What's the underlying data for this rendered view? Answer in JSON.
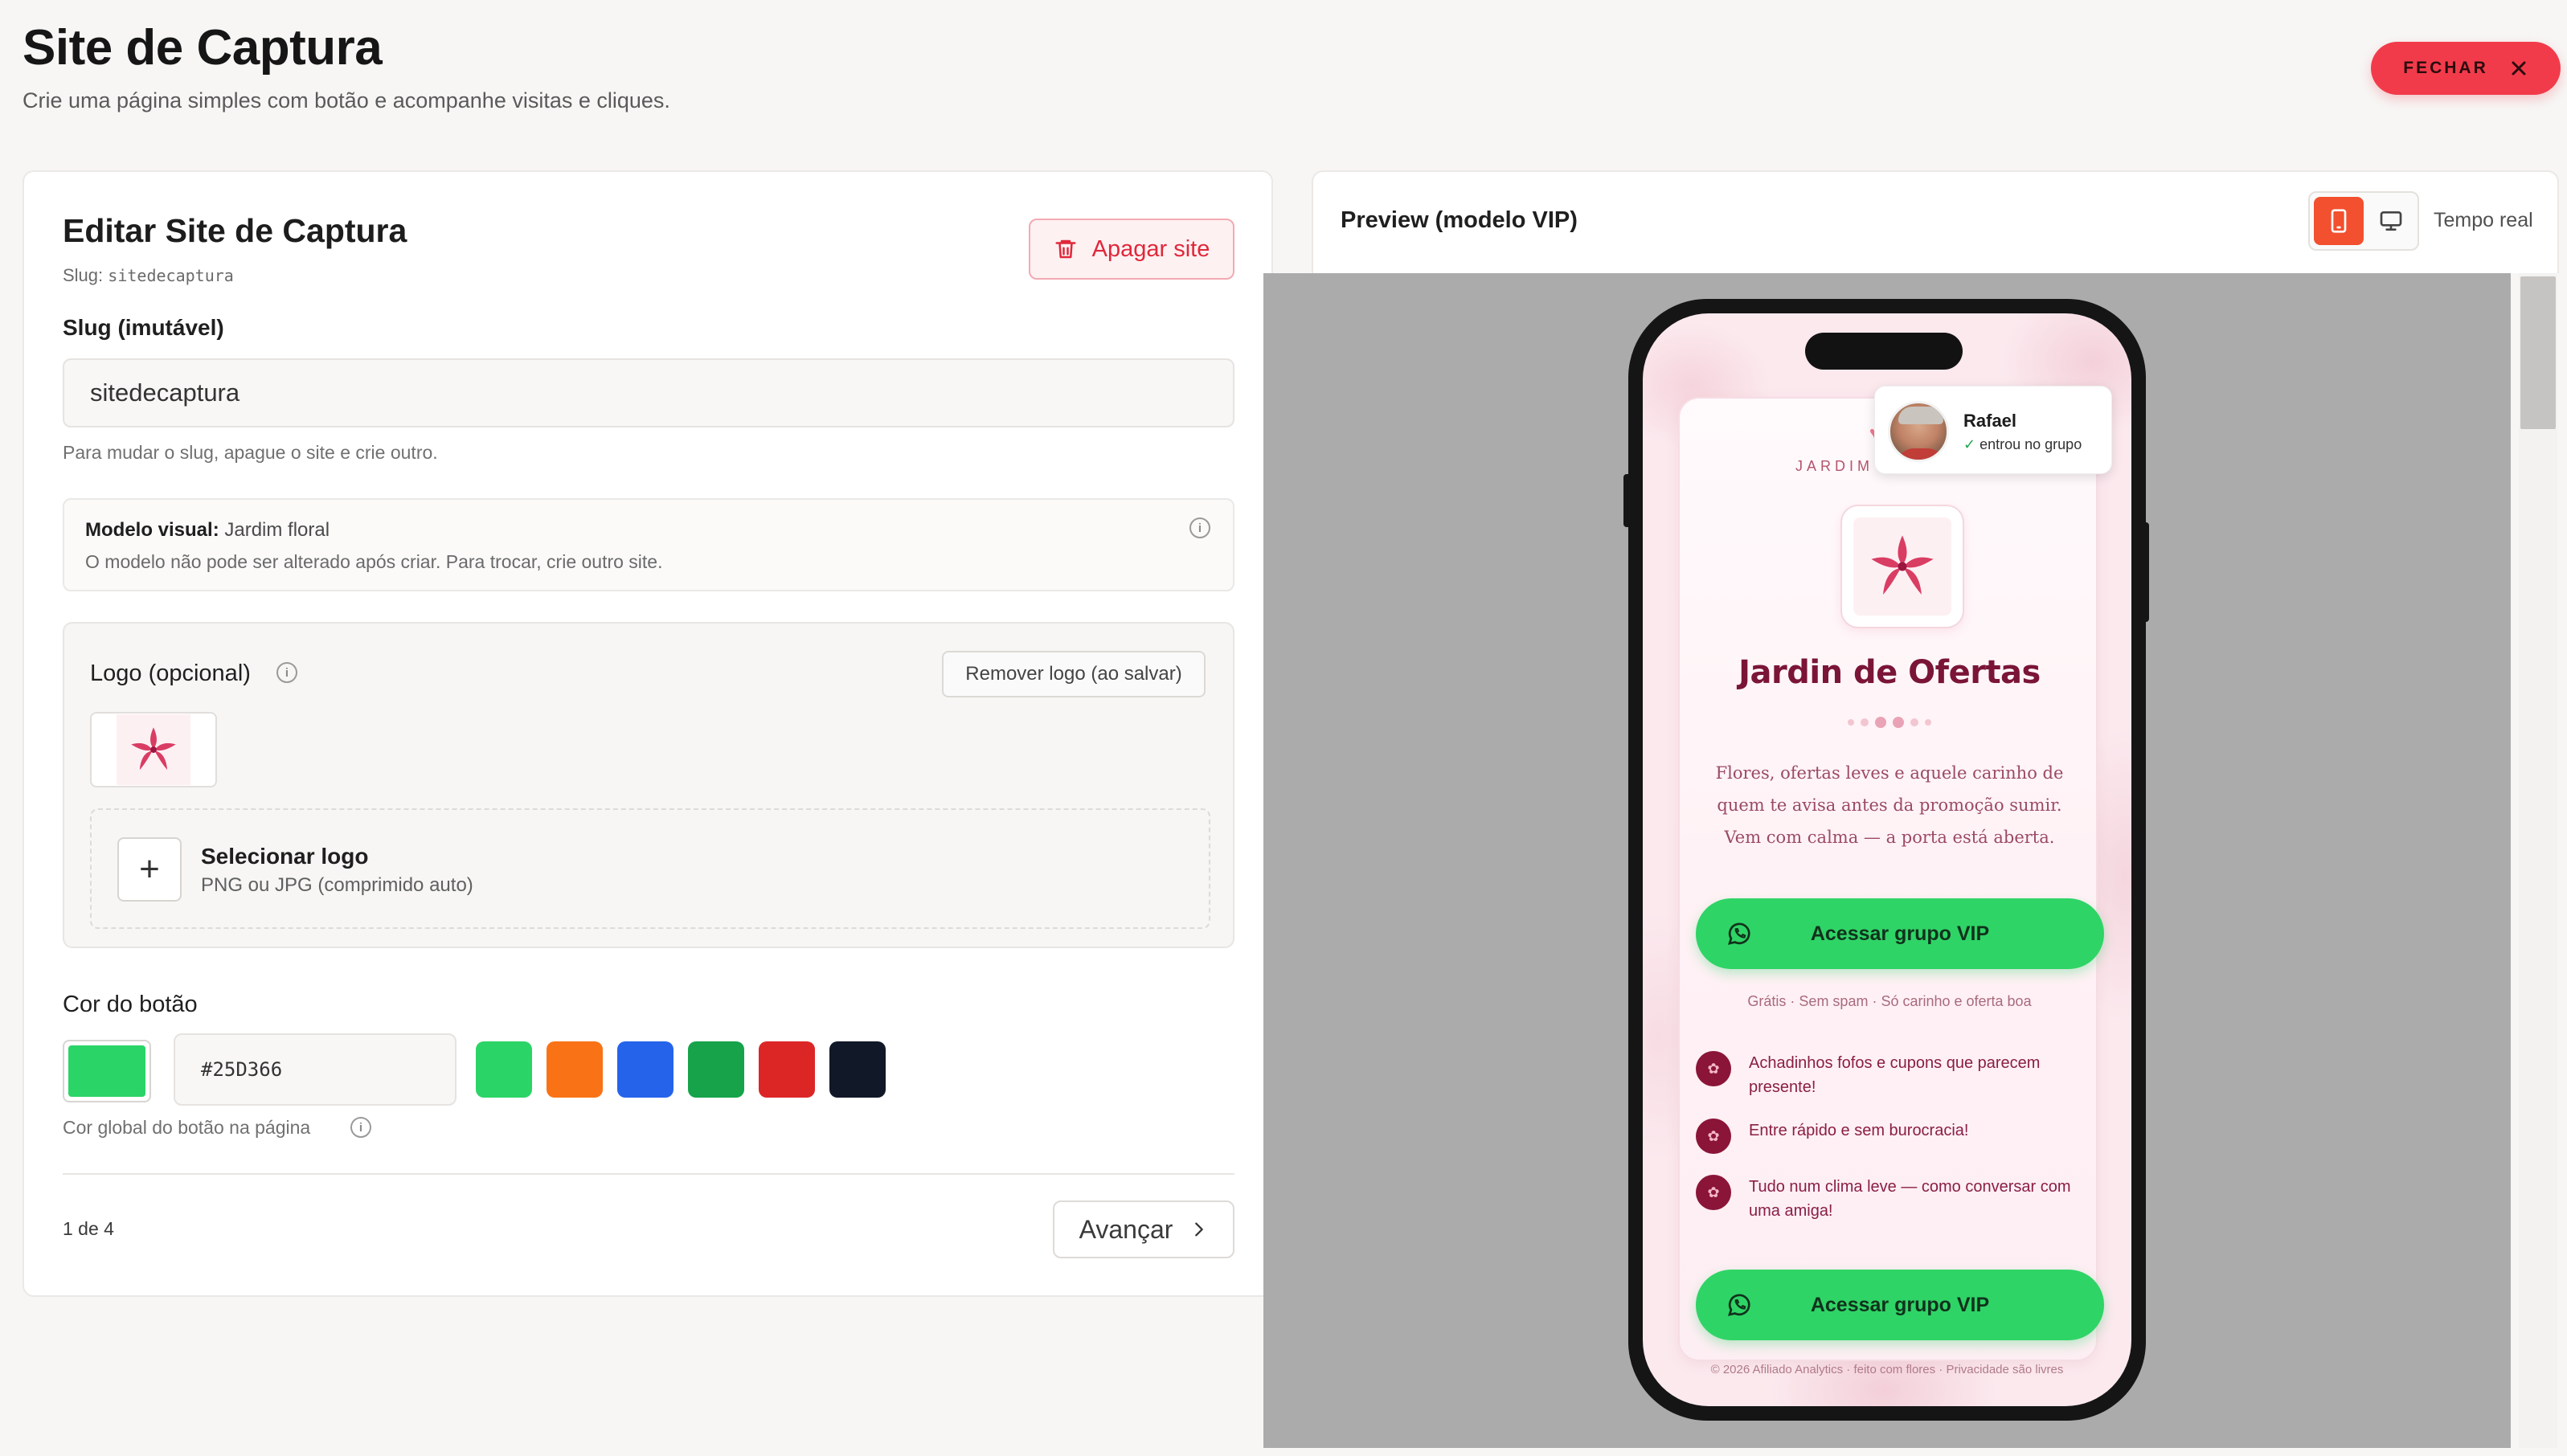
{
  "header": {
    "title": "Site de Captura",
    "subtitle": "Crie uma página simples com botão e acompanhe visitas e cliques.",
    "close_label": "FECHAR"
  },
  "editor": {
    "title": "Editar Site de Captura",
    "slug_prefix": "Slug:",
    "slug_value": "sitedecaptura",
    "delete_label": "Apagar site",
    "slug_field_label": "Slug (imutável)",
    "slug_input_value": "sitedecaptura",
    "slug_help": "Para mudar o slug, apague o site e crie outro.",
    "model": {
      "label": "Modelo visual:",
      "value": "Jardim floral",
      "note": "O modelo não pode ser alterado após criar. Para trocar, crie outro site."
    },
    "logo": {
      "title": "Logo (opcional)",
      "remove_label": "Remover logo (ao salvar)",
      "select_title": "Selecionar logo",
      "select_sub": "PNG ou JPG (comprimido auto)"
    },
    "button_color": {
      "label": "Cor do botão",
      "current": "#25D366",
      "hex_value": "#25D366",
      "help": "Cor global do botão na página",
      "swatches": [
        "#2bd466",
        "#f97316",
        "#2563eb",
        "#16a34a",
        "#dc2626",
        "#111827"
      ]
    },
    "step": "1 de 4",
    "next_label": "Avançar"
  },
  "preview": {
    "title": "Preview (modelo VIP)",
    "realtime_label": "Tempo real",
    "active_view": "mobile",
    "landing": {
      "brand_line": "JARDIM D",
      "title": "Jardin de Ofertas",
      "description": "Flores, ofertas leves e aquele carinho de quem te avisa antes da promoção sumir. Vem com calma — a porta está aberta.",
      "cta_label": "Acessar grupo VIP",
      "cta_label_bottom": "Acessar grupo VIP",
      "note": "Grátis · Sem spam · Só carinho e oferta boa",
      "bullets": [
        "Achadinhos fofos e cupons que parecem presente!",
        "Entre rápido e sem burocracia!",
        "Tudo num clima leve — como conversar com uma amiga!"
      ],
      "footer": "© 2026 Afiliado Analytics · feito com flores · Privacidade são livres"
    },
    "toast": {
      "name": "Rafael",
      "check": "✓",
      "status": "entrou no grupo"
    }
  },
  "colors": {
    "accent": "#f23b4a",
    "whatsapp_green": "#25D366",
    "brand_wine": "#7a1538"
  }
}
